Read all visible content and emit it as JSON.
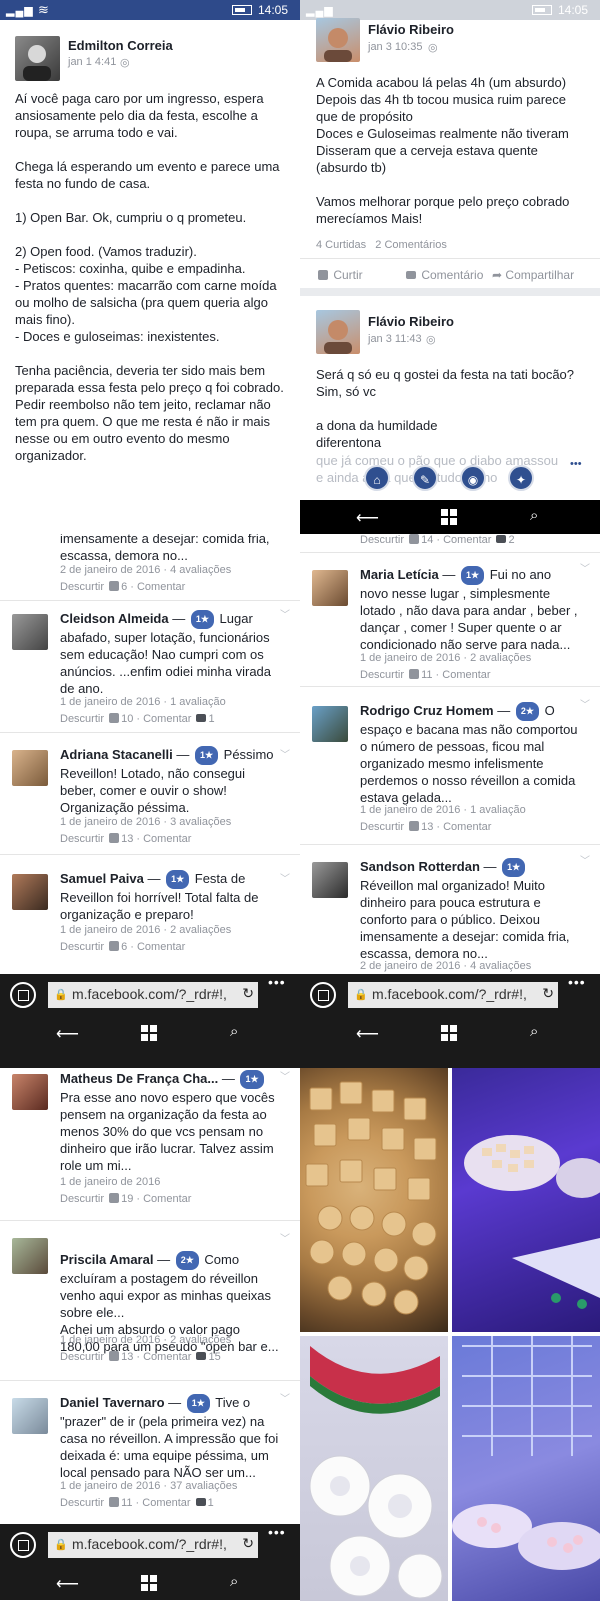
{
  "statusbar": {
    "signal": "▂▄▆",
    "wifi": "≋",
    "time": "14:05"
  },
  "panel1": {
    "post": {
      "author": "Edmilton Correia",
      "time": "jan 1 4:41",
      "text": "Aí você paga caro por um ingresso, espera ansiosamente pelo dia da festa, escolhe a roupa, se arruma todo e vai.\n\nChega lá esperando um evento e parece uma festa no fundo de casa.\n\n1) Open Bar. Ok, cumpriu o q prometeu.\n\n2) Open food. (Vamos traduzir).\n- Petiscos: coxinha, quibe e empadinha.\n- Pratos quentes: macarrão com carne moída ou molho de salsicha (pra quem queria algo mais fino).\n- Doces e guloseimas: inexistentes.\n\nTenha paciência, deveria ter sido mais bem preparada essa festa pelo preço q foi cobrado. Pedir reembolso não tem jeito, reclamar não tem pra quem. O que me resta é não ir mais nesse ou em outro evento do mesmo organizador."
    }
  },
  "panel2": {
    "post1": {
      "author": "Flávio Ribeiro",
      "time": "jan 3 10:35",
      "text": "A Comida acabou lá pelas 4h (um absurdo)\nDepois das 4h tb tocou musica ruim parece que de propósito\nDoces e Guloseimas realmente não tiveram\nDisseram que a cerveja estava quente (absurdo tb)\n\nVamos melhorar porque pelo preço cobrado merecíamos Mais!",
      "stats": "4 Curtidas   2 Comentários",
      "like": "Curtir",
      "comment": "Comentário",
      "share": "Compartilhar"
    },
    "post2": {
      "author": "Flávio Ribeiro",
      "time": "jan 3 11:43",
      "text": "Será q só eu q gostei da festa na tati bocão?\nSim, só vc\n\na dona da humildade\ndiferentona",
      "faded": "que já comeu o pão que o diabo amassou e ainda acha que foi tudo ótimo"
    }
  },
  "nav": {
    "back": "⟵",
    "search": "⌕"
  },
  "address": {
    "url": "m.facebook.com/?_rdr#!,",
    "reload": "↻",
    "lock": "🔒",
    "more": "•••"
  },
  "panel3": {
    "top_text": "imensamente a desejar: comida fria, escassa, demora no...",
    "top_meta": "2 de janeiro de 2016 · 4 avaliações",
    "top_actions": {
      "dislike": "Descurtir",
      "count": "6",
      "comment": "Comentar"
    },
    "reviews": [
      {
        "name": "Cleidson Almeida",
        "stars": "1★",
        "text": "Lugar abafado, super lotação, funcionários sem educação! Nao cumpri com os anúncios. ...enfim odiei minha virada de ano.",
        "meta": "1 de janeiro de 2016 · 1 avaliação",
        "dislike": "Descurtir",
        "likes": "10",
        "comment": "Comentar",
        "comments": "1"
      },
      {
        "name": "Adriana Stacanelli",
        "stars": "1★",
        "text": "Péssimo Reveillon! Lotado, não consegui beber, comer e ouvir o show! Organização péssima.",
        "meta": "1 de janeiro de 2016 · 3 avaliações",
        "dislike": "Descurtir",
        "likes": "13",
        "comment": "Comentar",
        "comments": ""
      },
      {
        "name": "Samuel Paiva",
        "stars": "1★",
        "text": "Festa de Reveillon foi horrível! Total falta de organização e preparo!",
        "meta": "1 de janeiro de 2016 · 2 avaliações",
        "dislike": "Descurtir",
        "likes": "6",
        "comment": "Comentar",
        "comments": ""
      }
    ]
  },
  "panel4": {
    "top_actions": {
      "dislike": "Descurtir",
      "likes": "14",
      "comment": "Comentar",
      "comments": "2"
    },
    "reviews": [
      {
        "name": "Maria Letícia",
        "stars": "1★",
        "text": "Fui no ano novo nesse lugar , simplesmente lotado , não dava para andar , beber , dançar , comer ! Super quente o ar condicionado não serve para nada...",
        "meta": "1 de janeiro de 2016 · 2 avaliações",
        "dislike": "Descurtir",
        "likes": "11",
        "comment": "Comentar",
        "comments": ""
      },
      {
        "name": "Rodrigo Cruz Homem",
        "stars": "2★",
        "text": "O espaço e bacana mas não comportou o número de pessoas, ficou mal organizado mesmo infelismente perdemos o nosso réveillon a comida estava gelada...",
        "meta": "1 de janeiro de 2016 · 1 avaliação",
        "dislike": "Descurtir",
        "likes": "13",
        "comment": "Comentar",
        "comments": ""
      },
      {
        "name": "Sandson Rotterdan",
        "stars": "1★",
        "text": "Réveillon mal organizado! Muito dinheiro para pouca estrutura e conforto para o público. Deixou imensamente a desejar: comida fria, escassa, demora no...",
        "meta": "2 de janeiro de 2016 · 4 avaliações",
        "dislike": "",
        "likes": "",
        "comment": "",
        "comments": ""
      }
    ]
  },
  "panel5": {
    "reviews": [
      {
        "name": "Matheus De França Cha...",
        "stars": "1★",
        "text": "Pra esse ano novo espero que vocês pensem na organização da festa ao menos 30% do que vcs pensam no dinheiro que irão lucrar. Talvez assim role um mi...",
        "meta": "1 de janeiro de 2016",
        "dislike": "Descurtir",
        "likes": "19",
        "comment": "Comentar",
        "comments": ""
      },
      {
        "name": "Priscila Amaral",
        "stars": "2★",
        "text": "Como excluíram a postagem do réveillon venho aqui expor as minhas queixas sobre ele...\nAchei um absurdo o valor pago 180,00 para um pseudo \"open bar e...",
        "meta": "1 de janeiro de 2016 · 2 avaliações",
        "dislike": "Descurtir",
        "likes": "13",
        "comment": "Comentar",
        "comments": "15"
      },
      {
        "name": "Daniel Tavernaro",
        "stars": "1★",
        "text": "Tive o \"prazer\" de ir (pela primeira vez) na casa no réveillon. A impressão que foi deixada é: uma equipe péssima, um local pensado para NÃO ser um...",
        "meta": "1 de janeiro de 2016 · 37 avaliações",
        "dislike": "Descurtir",
        "likes": "11",
        "comment": "Comentar",
        "comments": "1"
      }
    ]
  }
}
